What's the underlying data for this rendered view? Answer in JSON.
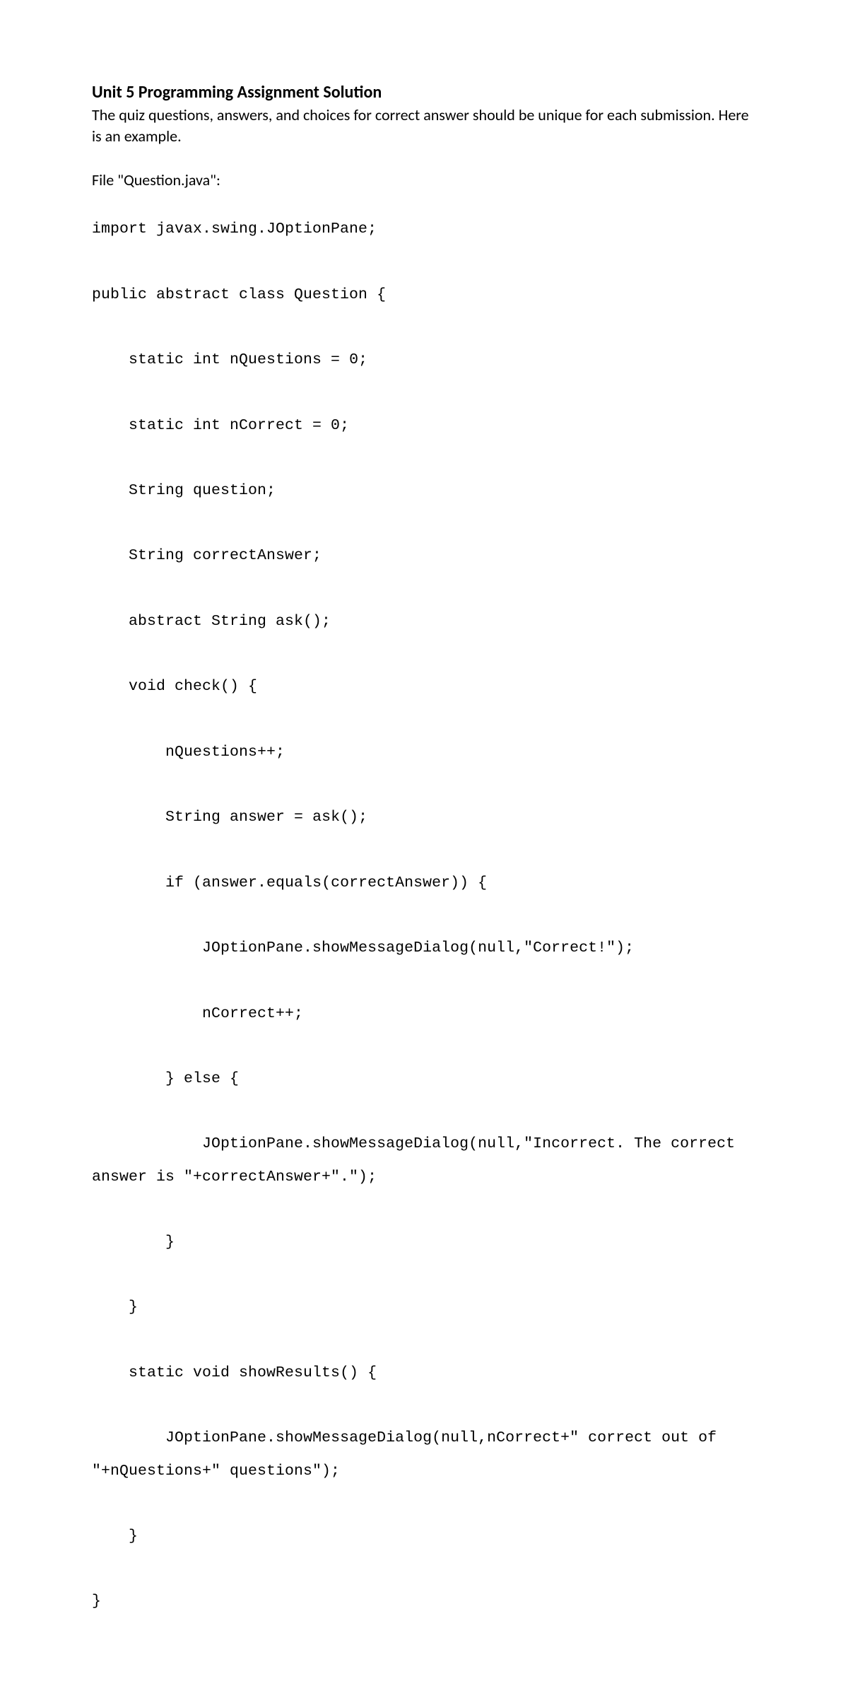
{
  "heading": "Unit 5 Programming Assignment Solution",
  "intro": "The quiz questions, answers, and choices for correct answer should be unique for each submission. Here is an example.",
  "file_label": "File \"Question.java\":",
  "code": "import javax.swing.JOptionPane;\n\npublic abstract class Question {\n\n    static int nQuestions = 0;\n\n    static int nCorrect = 0;\n\n    String question;\n\n    String correctAnswer;\n\n    abstract String ask();\n\n    void check() {\n\n        nQuestions++;\n\n        String answer = ask();\n\n        if (answer.equals(correctAnswer)) {\n\n            JOptionPane.showMessageDialog(null,\"Correct!\");\n\n            nCorrect++;\n\n        } else {\n\n            JOptionPane.showMessageDialog(null,\"Incorrect. The correct answer is \"+correctAnswer+\".\");\n\n        }\n\n    }\n\n    static void showResults() {\n\n        JOptionPane.showMessageDialog(null,nCorrect+\" correct out of \"+nQuestions+\" questions\");\n\n    }\n\n}"
}
